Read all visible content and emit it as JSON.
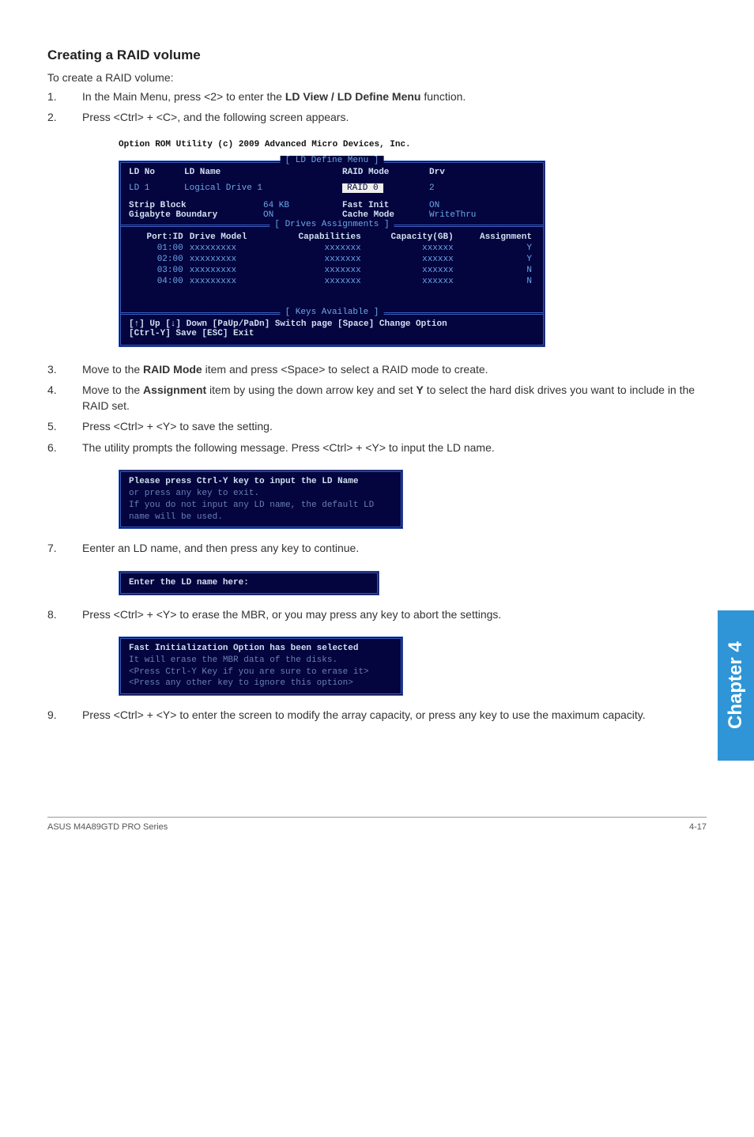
{
  "section_title": "Creating a RAID volume",
  "intro": "To create a RAID volume:",
  "steps_top": [
    {
      "n": "1.",
      "pre": "In the Main Menu, press <2> to enter the ",
      "bold": "LD View / LD Define Menu",
      "post": " function."
    },
    {
      "n": "2.",
      "pre": "Press <Ctrl> + <C>, and the following screen appears.",
      "bold": "",
      "post": ""
    }
  ],
  "bios": {
    "caption": "Option ROM Utility (c) 2009 Advanced Micro Devices, Inc.",
    "define_title": "[ LD Define Menu ]",
    "headers1": {
      "ldno": "LD No",
      "ldname": "LD Name",
      "raidmode": "RAID Mode",
      "drv": "Drv"
    },
    "row1": {
      "ldno": "LD  1",
      "ldname": "Logical Drive 1",
      "raidmode": " RAID 0 ",
      "drv": "2"
    },
    "row2a": {
      "k": "Strip Block",
      "v": "64 KB",
      "k2": "Fast Init",
      "v2": "ON"
    },
    "row2b": {
      "k": "Gigabyte Boundary",
      "v": "ON",
      "k2": "Cache Mode",
      "v2": "WriteThru"
    },
    "drives_title": "[ Drives Assignments ]",
    "drives_hdr": [
      "Port:ID",
      "Drive Model",
      "Capabilities",
      "Capacity(GB)",
      "Assignment"
    ],
    "drives_rows": [
      [
        "01:00",
        "xxxxxxxxx",
        "xxxxxxx",
        "xxxxxx",
        "Y"
      ],
      [
        "02:00",
        "xxxxxxxxx",
        "xxxxxxx",
        "xxxxxx",
        "Y"
      ],
      [
        "03:00",
        "xxxxxxxxx",
        "xxxxxxx",
        "xxxxxx",
        "N"
      ],
      [
        "04:00",
        "xxxxxxxxx",
        "xxxxxxx",
        "xxxxxx",
        "N"
      ]
    ],
    "keys_title": "[ Keys Available ]",
    "keys_line1": "[↑] Up  [↓] Down  [PaUp/PaDn] Switch page  [Space] Change Option",
    "keys_line2": "[Ctrl-Y] Save  [ESC] Exit"
  },
  "steps_mid": [
    {
      "n": "3.",
      "html": "Move to the <b>RAID Mode</b> item and press <Space> to select a RAID mode to create."
    },
    {
      "n": "4.",
      "html": "Move to the <b>Assignment</b> item by using the down arrow key and set <b>Y</b> to select the hard disk drives you want to include in the RAID set."
    },
    {
      "n": "5.",
      "html": "Press <Ctrl> + <Y> to save the setting."
    },
    {
      "n": "6.",
      "html": "The utility prompts the following message. Press <Ctrl> + <Y> to input the LD name."
    }
  ],
  "msg1": {
    "l1": "Please press Ctrl-Y key to input the LD Name",
    "l2": "or press any key to exit.",
    "l3": "If you do not input any LD name, the default LD",
    "l4": "name will be used."
  },
  "step7": {
    "n": "7.",
    "text": "Eenter an LD name, and then press any key to continue."
  },
  "inputbox": "Enter the LD name here:",
  "step8": {
    "n": "8.",
    "text": "Press <Ctrl> + <Y> to erase the MBR, or you may press any key to abort the settings."
  },
  "msg2": {
    "l1": "Fast Initialization Option has been selected",
    "l2": "It will erase the MBR data of the disks.",
    "l3": "<Press Ctrl-Y Key if you are sure to erase it>",
    "l4": "<Press any other key to ignore this option>"
  },
  "step9": {
    "n": "9.",
    "text": "Press <Ctrl> + <Y> to enter the screen to modify the array capacity, or press any key to use the maximum capacity."
  },
  "sidetab": "Chapter 4",
  "footer_left": "ASUS M4A89GTD PRO Series",
  "footer_right": "4-17"
}
